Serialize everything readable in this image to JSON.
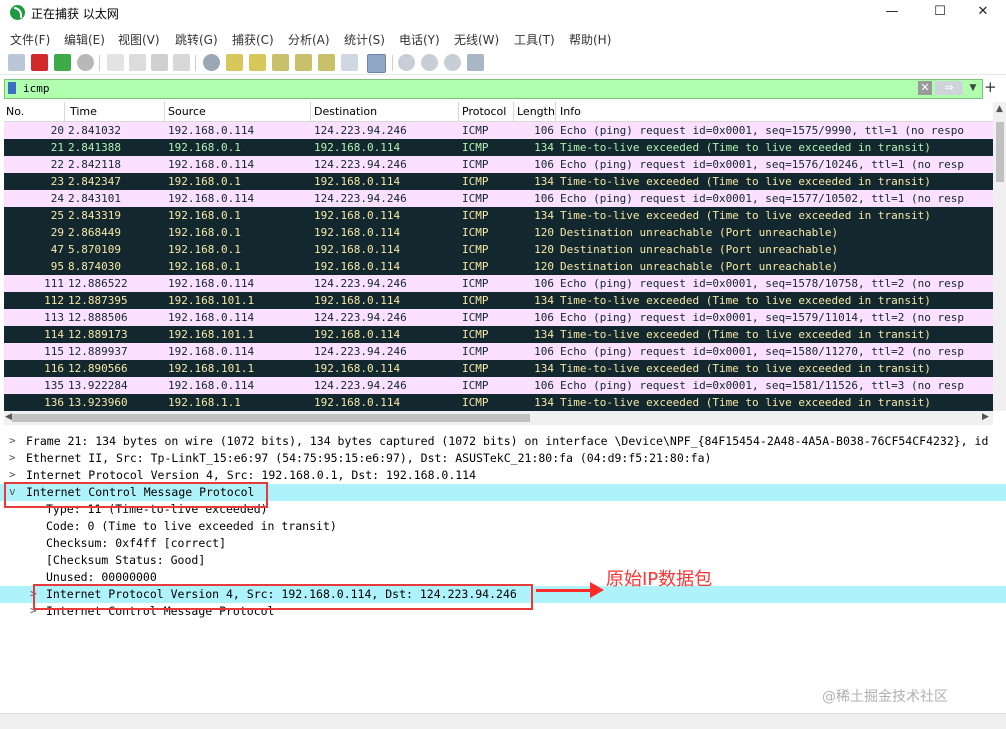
{
  "window": {
    "title": "正在捕获 以太网",
    "minimize": "—",
    "maximize": "☐",
    "close": "✕"
  },
  "menu": [
    "文件(F)",
    "编辑(E)",
    "视图(V)",
    "跳转(G)",
    "捕获(C)",
    "分析(A)",
    "统计(S)",
    "电话(Y)",
    "无线(W)",
    "工具(T)",
    "帮助(H)"
  ],
  "filter": {
    "value": "icmp",
    "clear": "✕",
    "apply": "⇒",
    "dropdown": "▼",
    "add": "+"
  },
  "columns": [
    "No.",
    "Time",
    "Source",
    "Destination",
    "Protocol",
    "Length",
    "Info"
  ],
  "packets": [
    {
      "no": "20",
      "time": "2.841032",
      "src": "192.168.0.114",
      "dst": "124.223.94.246",
      "proto": "ICMP",
      "len": "106",
      "info": "Echo (ping) request  id=0x0001, seq=1575/9990, ttl=1 (no respo",
      "kind": "req"
    },
    {
      "no": "21",
      "time": "2.841388",
      "src": "192.168.0.1",
      "dst": "192.168.0.114",
      "proto": "ICMP",
      "len": "134",
      "info": "Time-to-live exceeded (Time to live exceeded in transit)",
      "kind": "ttl"
    },
    {
      "no": "22",
      "time": "2.842118",
      "src": "192.168.0.114",
      "dst": "124.223.94.246",
      "proto": "ICMP",
      "len": "106",
      "info": "Echo (ping) request  id=0x0001, seq=1576/10246, ttl=1 (no resp",
      "kind": "req"
    },
    {
      "no": "23",
      "time": "2.842347",
      "src": "192.168.0.1",
      "dst": "192.168.0.114",
      "proto": "ICMP",
      "len": "134",
      "info": "Time-to-live exceeded (Time to live exceeded in transit)",
      "kind": "ttl"
    },
    {
      "no": "24",
      "time": "2.843101",
      "src": "192.168.0.114",
      "dst": "124.223.94.246",
      "proto": "ICMP",
      "len": "106",
      "info": "Echo (ping) request  id=0x0001, seq=1577/10502, ttl=1 (no resp",
      "kind": "req"
    },
    {
      "no": "25",
      "time": "2.843319",
      "src": "192.168.0.1",
      "dst": "192.168.0.114",
      "proto": "ICMP",
      "len": "134",
      "info": "Time-to-live exceeded (Time to live exceeded in transit)",
      "kind": "ttl"
    },
    {
      "no": "29",
      "time": "2.868449",
      "src": "192.168.0.1",
      "dst": "192.168.0.114",
      "proto": "ICMP",
      "len": "120",
      "info": "Destination unreachable (Port unreachable)",
      "kind": "ttl"
    },
    {
      "no": "47",
      "time": "5.870109",
      "src": "192.168.0.1",
      "dst": "192.168.0.114",
      "proto": "ICMP",
      "len": "120",
      "info": "Destination unreachable (Port unreachable)",
      "kind": "ttl"
    },
    {
      "no": "95",
      "time": "8.874030",
      "src": "192.168.0.1",
      "dst": "192.168.0.114",
      "proto": "ICMP",
      "len": "120",
      "info": "Destination unreachable (Port unreachable)",
      "kind": "ttl"
    },
    {
      "no": "111",
      "time": "12.886522",
      "src": "192.168.0.114",
      "dst": "124.223.94.246",
      "proto": "ICMP",
      "len": "106",
      "info": "Echo (ping) request  id=0x0001, seq=1578/10758, ttl=2 (no resp",
      "kind": "req"
    },
    {
      "no": "112",
      "time": "12.887395",
      "src": "192.168.101.1",
      "dst": "192.168.0.114",
      "proto": "ICMP",
      "len": "134",
      "info": "Time-to-live exceeded (Time to live exceeded in transit)",
      "kind": "ttl"
    },
    {
      "no": "113",
      "time": "12.888506",
      "src": "192.168.0.114",
      "dst": "124.223.94.246",
      "proto": "ICMP",
      "len": "106",
      "info": "Echo (ping) request  id=0x0001, seq=1579/11014, ttl=2 (no resp",
      "kind": "req"
    },
    {
      "no": "114",
      "time": "12.889173",
      "src": "192.168.101.1",
      "dst": "192.168.0.114",
      "proto": "ICMP",
      "len": "134",
      "info": "Time-to-live exceeded (Time to live exceeded in transit)",
      "kind": "ttl"
    },
    {
      "no": "115",
      "time": "12.889937",
      "src": "192.168.0.114",
      "dst": "124.223.94.246",
      "proto": "ICMP",
      "len": "106",
      "info": "Echo (ping) request  id=0x0001, seq=1580/11270, ttl=2 (no resp",
      "kind": "req"
    },
    {
      "no": "116",
      "time": "12.890566",
      "src": "192.168.101.1",
      "dst": "192.168.0.114",
      "proto": "ICMP",
      "len": "134",
      "info": "Time-to-live exceeded (Time to live exceeded in transit)",
      "kind": "ttl"
    },
    {
      "no": "135",
      "time": "13.922284",
      "src": "192.168.0.114",
      "dst": "124.223.94.246",
      "proto": "ICMP",
      "len": "106",
      "info": "Echo (ping) request  id=0x0001, seq=1581/11526, ttl=3 (no resp",
      "kind": "req"
    },
    {
      "no": "136",
      "time": "13.923960",
      "src": "192.168.1.1",
      "dst": "192.168.0.114",
      "proto": "ICMP",
      "len": "134",
      "info": "Time-to-live exceeded (Time to live exceeded in transit)",
      "kind": "ttl"
    }
  ],
  "details": [
    {
      "toggle": ">",
      "indent": 0,
      "text": "Frame 21: 134 bytes on wire (1072 bits), 134 bytes captured (1072 bits) on interface \\Device\\NPF_{84F15454-2A48-4A5A-B038-76CF54CF4232}, id"
    },
    {
      "toggle": ">",
      "indent": 0,
      "text": "Ethernet II, Src: Tp-LinkT_15:e6:97 (54:75:95:15:e6:97), Dst: ASUSTekC_21:80:fa (04:d9:f5:21:80:fa)"
    },
    {
      "toggle": ">",
      "indent": 0,
      "text": "Internet Protocol Version 4, Src: 192.168.0.1, Dst: 192.168.0.114"
    },
    {
      "toggle": "v",
      "indent": 0,
      "text": "Internet Control Message Protocol",
      "highlight": true
    },
    {
      "toggle": "",
      "indent": 1,
      "text": "Type: 11 (Time-to-live exceeded)"
    },
    {
      "toggle": "",
      "indent": 1,
      "text": "Code: 0 (Time to live exceeded in transit)"
    },
    {
      "toggle": "",
      "indent": 1,
      "text": "Checksum: 0xf4ff [correct]"
    },
    {
      "toggle": "",
      "indent": 1,
      "text": "[Checksum Status: Good]"
    },
    {
      "toggle": "",
      "indent": 1,
      "text": "Unused: 00000000"
    },
    {
      "toggle": ">",
      "indent": 1,
      "text": "Internet Protocol Version 4, Src: 192.168.0.114, Dst: 124.223.94.246",
      "highlight": true
    },
    {
      "toggle": ">",
      "indent": 1,
      "text": "Internet Control Message Protocol"
    }
  ],
  "annotation": "原始IP数据包",
  "watermark": "@稀土掘金技术社区",
  "colors": {
    "request_row": "#fce0ff",
    "ttl_row_bg": "#12272e",
    "ttl_row_fg": "#f7e8a7",
    "highlight": "#aef3fc",
    "filter_ok": "#afffaf",
    "annotation_red": "#ff2b2b"
  }
}
